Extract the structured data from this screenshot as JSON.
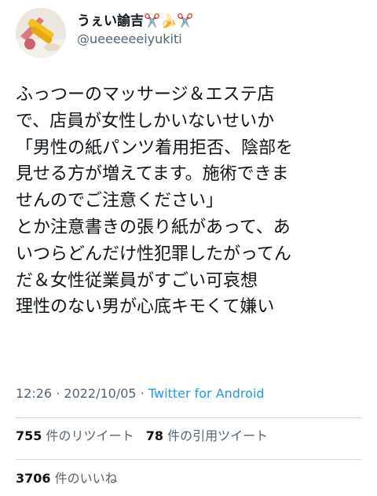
{
  "author": {
    "display_name": "うぇい諭吉",
    "display_name_emojis": "✂️🍌✂️",
    "handle": "@ueeeeeeiyukiti"
  },
  "tweet": {
    "lines": [
      "ふっつーのマッサージ＆エステ店",
      "で、店員が女性しかいないせいか",
      "「男性の紙パンツ着用拒否、陰部を",
      "見せる方が増えてます。施術できま",
      "せんのでご注意ください」",
      "とか注意書きの張り紙があって、あ",
      "いつらどんだけ性犯罪したがってん",
      "だ＆女性従業員がすごい可哀想",
      "理性のない男が心底キモくて嫌い"
    ],
    "time": "12:26",
    "separator": "·",
    "date": "2022/10/05",
    "source": "Twitter for Android"
  },
  "stats": {
    "retweets_count": "755",
    "retweets_label": "件のリツイート",
    "quotes_count": "78",
    "quotes_label": "件の引用ツイート",
    "likes_count": "3706",
    "likes_label": "件のいいね"
  }
}
